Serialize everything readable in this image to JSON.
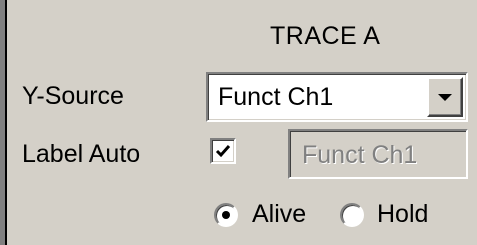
{
  "panel": {
    "title": "TRACE A"
  },
  "y_source": {
    "label": "Y-Source",
    "selected": "Funct Ch1"
  },
  "label_auto": {
    "label": "Label Auto",
    "checked": true,
    "field_value": "Funct Ch1"
  },
  "mode": {
    "options": [
      {
        "label": "Alive",
        "selected": true
      },
      {
        "label": "Hold",
        "selected": false
      }
    ]
  },
  "icons": {
    "combo_arrow": "chevron-down-icon",
    "checkbox_mark": "checkmark-icon"
  }
}
